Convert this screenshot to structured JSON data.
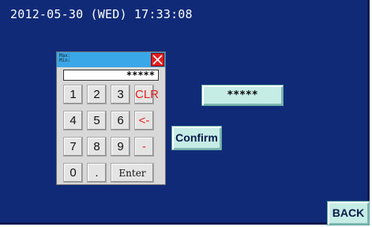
{
  "header": {
    "datetime": "2012-05-30 (WED) 17:33:08"
  },
  "keypad": {
    "max_label": "Max:",
    "min_label": "Min:",
    "display_value": "*****",
    "close_icon": "close-icon",
    "keys": {
      "k1": "1",
      "k2": "2",
      "k3": "3",
      "clr": "CLR",
      "k4": "4",
      "k5": "5",
      "k6": "6",
      "back": "<-",
      "k7": "7",
      "k8": "8",
      "k9": "9",
      "minus": "-",
      "k0": "0",
      "dot": ".",
      "enter": "Enter"
    }
  },
  "password_field": {
    "value": "*****"
  },
  "buttons": {
    "confirm": "Confirm",
    "back": "BACK"
  },
  "colors": {
    "screen_bg": "#102a78",
    "keypad_titlebar": "#3aa7e8",
    "close_button": "#e11e1e",
    "red_key_text": "#e62020",
    "button_face": "#c6ece6"
  }
}
